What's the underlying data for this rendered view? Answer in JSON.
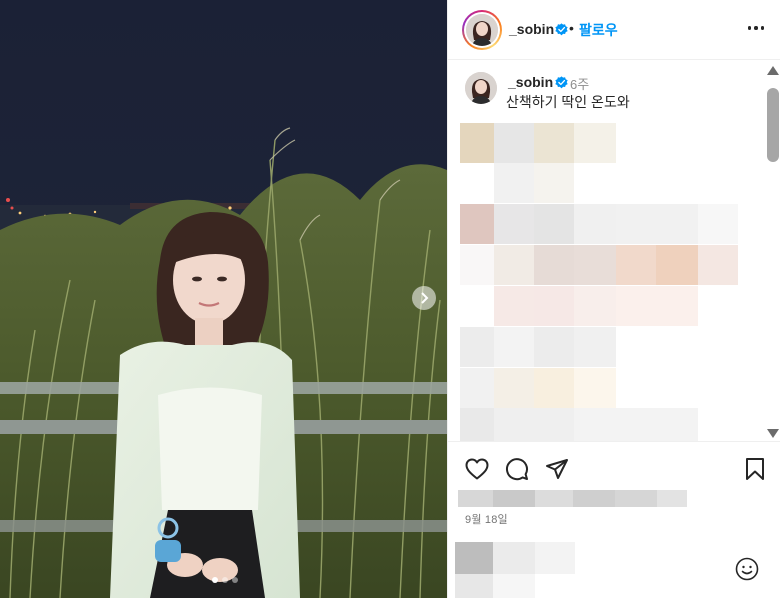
{
  "post": {
    "username": "_sobin",
    "separator": "•",
    "follow_label": "팔로우",
    "time_ago": "6주",
    "caption": "산책하기 딱인 온도와",
    "date": "9월 18일"
  },
  "icons": {
    "verified": "verified-badge-icon",
    "more": "more-options-icon",
    "like": "heart-icon",
    "comment": "comment-icon",
    "share": "send-icon",
    "save": "bookmark-icon",
    "emoji": "emoji-icon",
    "next": "chevron-right-icon"
  },
  "carousel": {
    "slide_count": 3,
    "active_index": 0
  },
  "colors": {
    "accent": "#0095f6",
    "text": "#262626",
    "muted": "#8e8e8e"
  }
}
